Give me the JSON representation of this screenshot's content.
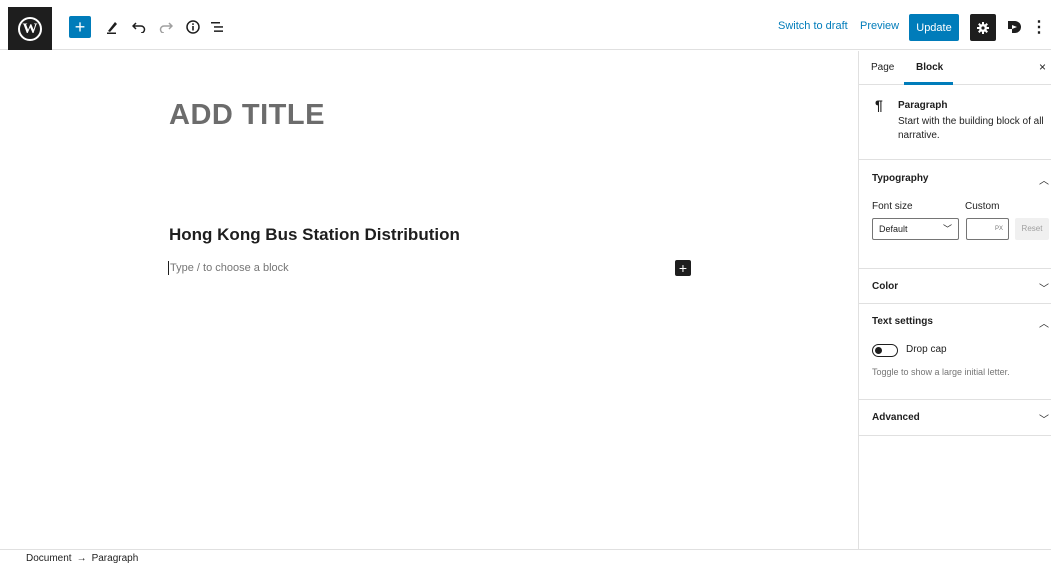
{
  "toolbar": {
    "add_block_symbol": "+",
    "switch_to_draft": "Switch to draft",
    "preview": "Preview",
    "update": "Update",
    "more_symbol": "⋮"
  },
  "editor": {
    "title_placeholder": "ADD TITLE",
    "heading": "Hong Kong Bus Station Distribution",
    "paragraph_placeholder": "Type / to choose a block",
    "inline_add_symbol": "+"
  },
  "sidebar": {
    "tabs": [
      {
        "label": "Page",
        "active": false
      },
      {
        "label": "Block",
        "active": true
      }
    ],
    "close_symbol": "×",
    "block_card": {
      "icon": "pilcrow-icon",
      "title": "Paragraph",
      "description": "Start with the building block of all narrative."
    },
    "typography": {
      "title": "Typography",
      "font_size_label": "Font size",
      "custom_label": "Custom",
      "font_size_value": "Default",
      "custom_unit": "PX",
      "reset_label": "Reset",
      "expanded": true
    },
    "color": {
      "title": "Color",
      "expanded": false
    },
    "text_settings": {
      "title": "Text settings",
      "drop_cap_label": "Drop cap",
      "drop_cap_enabled": false,
      "help": "Toggle to show a large initial letter.",
      "expanded": true
    },
    "advanced": {
      "title": "Advanced",
      "expanded": false
    }
  },
  "footer": {
    "breadcrumb": [
      "Document",
      "Paragraph"
    ],
    "separator": "→"
  },
  "colors": {
    "accent": "#007cba",
    "dark": "#1e1e1e",
    "muted": "#757575"
  }
}
